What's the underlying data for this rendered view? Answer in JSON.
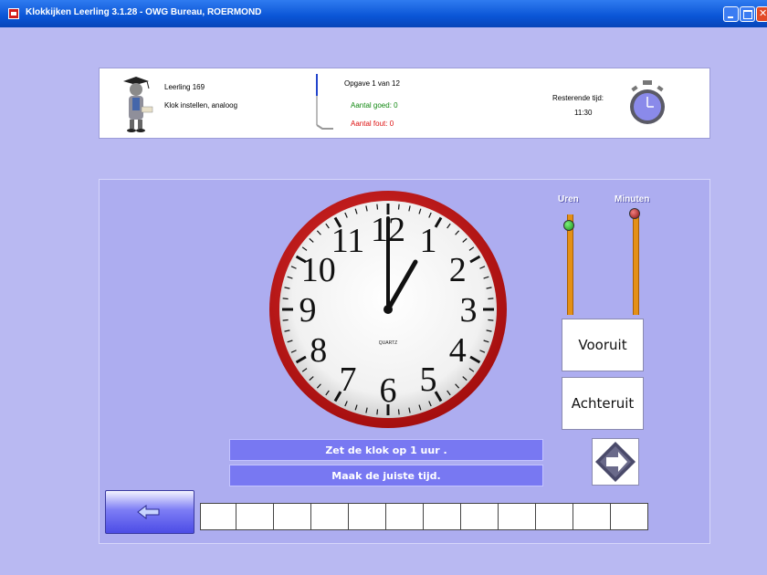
{
  "window": {
    "title": "Klokkijken Leerling  3.1.28 - OWG Bureau, ROERMOND"
  },
  "header": {
    "student": "Leerling 169",
    "exercise": "Klok instellen, analoog",
    "task": "Opgave 1 van 12",
    "good": "Aantal goed: 0",
    "wrong": "Aantal fout: 0",
    "time_label": "Resterende tijd:",
    "time_value": "11:30"
  },
  "clock": {
    "brand": "QUARTZ",
    "numbers": [
      "12",
      "1",
      "2",
      "3",
      "4",
      "5",
      "6",
      "7",
      "8",
      "9",
      "10",
      "11"
    ],
    "hour": 1,
    "minute": 0
  },
  "sliders": {
    "hours_label": "Uren",
    "minutes_label": "Minuten"
  },
  "buttons": {
    "forward": "Vooruit",
    "back": "Achteruit"
  },
  "instructions": {
    "line1": "Zet de klok op 1 uur .",
    "line2": "Maak de juiste tijd."
  },
  "progress": {
    "total": 12,
    "done": 0
  },
  "colors": {
    "background": "#b9b9f2",
    "instruction_bar": "#7878f2",
    "clock_rim": "#cc1c1c",
    "good": "#118811",
    "wrong": "#dd1111"
  }
}
